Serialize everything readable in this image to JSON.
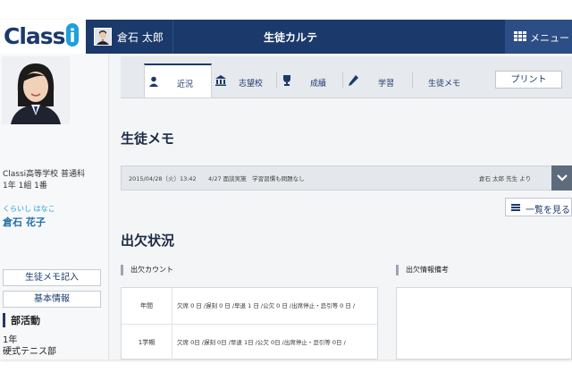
{
  "header": {
    "logo": "Classi",
    "user_name": "倉石 太郎",
    "title": "生徒カルテ",
    "menu_label": "メニュー",
    "colors": {
      "header_bg": "#1b3a6b",
      "logo_accent": "#1ea0dc"
    }
  },
  "sidebar": {
    "school": "Classi高等学校 普通科",
    "class_info": "1年 1組 1番",
    "name_kana": "くらいし はなこ",
    "name": "倉石 花子",
    "buttons": [
      "生徒メモ記入",
      "基本情報"
    ],
    "club_heading": "部活動",
    "club_year": "1年",
    "club_name": "硬式テニス部"
  },
  "tabs": [
    {
      "label": "近況",
      "icon": "person-icon",
      "active": true
    },
    {
      "label": "志望校",
      "icon": "school-icon",
      "active": false
    },
    {
      "label": "成績",
      "icon": "trophy-icon",
      "active": false
    },
    {
      "label": "学習",
      "icon": "pencil-icon",
      "active": false
    },
    {
      "label": "生徒メモ",
      "icon": "",
      "active": false
    }
  ],
  "print_label": "プリント",
  "memo": {
    "heading": "生徒メモ",
    "date": "2015/04/28（火）13:42",
    "text": "4/27 面談実施　学習習慣も問題なし",
    "author": "倉石 太郎 先生 より",
    "list_button": "一覧を見る"
  },
  "attendance": {
    "heading": "出欠状況",
    "count_label": "出欠カウント",
    "remarks_label": "出欠情報備考",
    "rows": [
      {
        "term": "年間",
        "values": "欠席 0 日 /遅刻 0 日 /早退 1 日 /公欠 0 日 /出席停止・忌引等 0 日 /"
      },
      {
        "term": "1学期",
        "values": "欠席 0日 /遅刻 0日 /早退 1日 /公欠 0日 /出席停止・忌引等 0日 /"
      }
    ]
  }
}
